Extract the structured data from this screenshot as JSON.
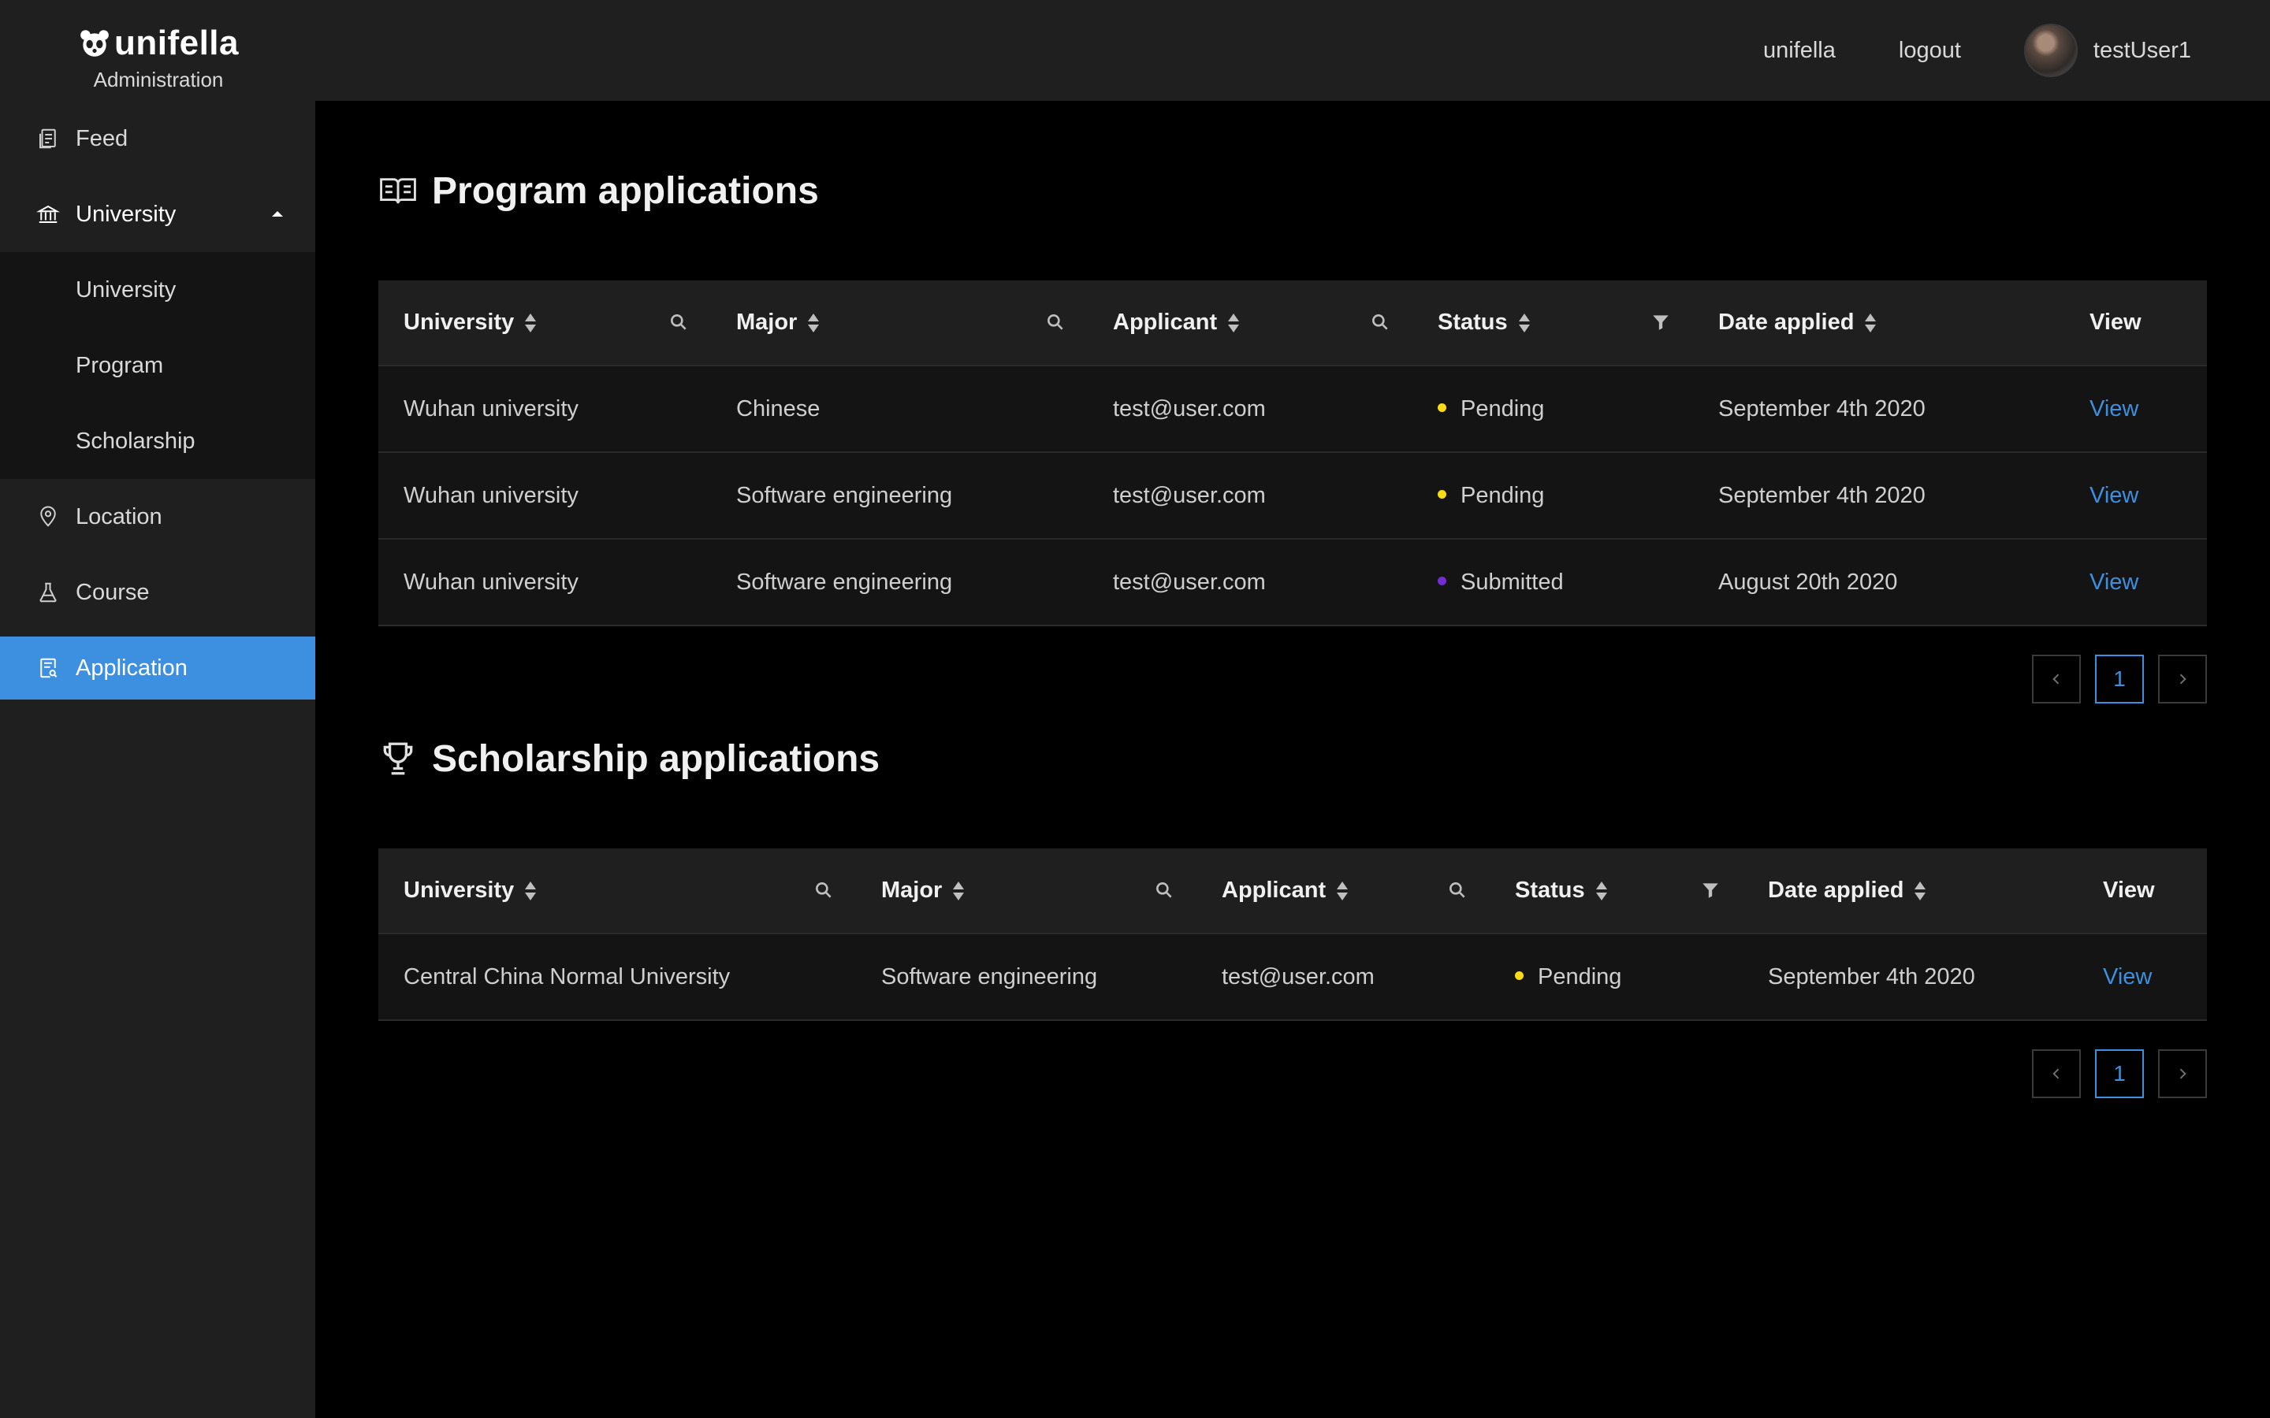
{
  "brand": {
    "name": "unifella",
    "subtitle": "Administration"
  },
  "topnav": {
    "links": [
      "unifella",
      "logout"
    ],
    "user": "testUser1"
  },
  "sidebar": {
    "items": [
      {
        "label": "Feed",
        "icon": "file-copy-icon"
      },
      {
        "label": "University",
        "icon": "bank-icon",
        "expanded": true,
        "children": [
          {
            "label": "University"
          },
          {
            "label": "Program"
          },
          {
            "label": "Scholarship"
          }
        ]
      },
      {
        "label": "Location",
        "icon": "map-pin-icon"
      },
      {
        "label": "Course",
        "icon": "flask-icon"
      },
      {
        "label": "Application",
        "icon": "file-search-icon",
        "active": true
      }
    ]
  },
  "program_section": {
    "title": "Program applications",
    "icon": "open-book-icon",
    "columns": [
      "University",
      "Major",
      "Applicant",
      "Status",
      "Date applied",
      "View"
    ],
    "rows": [
      {
        "university": "Wuhan university",
        "major": "Chinese",
        "applicant": "test@user.com",
        "status": "Pending",
        "status_color": "#fadb14",
        "date": "September 4th 2020",
        "view": "View"
      },
      {
        "university": "Wuhan university",
        "major": "Software engineering",
        "applicant": "test@user.com",
        "status": "Pending",
        "status_color": "#fadb14",
        "date": "September 4th 2020",
        "view": "View"
      },
      {
        "university": "Wuhan university",
        "major": "Software engineering",
        "applicant": "test@user.com",
        "status": "Submitted",
        "status_color": "#722ed1",
        "date": "August 20th 2020",
        "view": "View"
      }
    ],
    "pagination": {
      "current": "1"
    }
  },
  "scholarship_section": {
    "title": "Scholarship applications",
    "icon": "trophy-icon",
    "columns": [
      "University",
      "Major",
      "Applicant",
      "Status",
      "Date applied",
      "View"
    ],
    "rows": [
      {
        "university": "Central China Normal University",
        "major": "Software engineering",
        "applicant": "test@user.com",
        "status": "Pending",
        "status_color": "#fadb14",
        "date": "September 4th 2020",
        "view": "View"
      }
    ],
    "pagination": {
      "current": "1"
    }
  },
  "colors": {
    "accent": "#3d8fe0",
    "sidebar_bg": "#1f1f1f",
    "submenu_bg": "#141414",
    "page_bg": "#000000"
  }
}
